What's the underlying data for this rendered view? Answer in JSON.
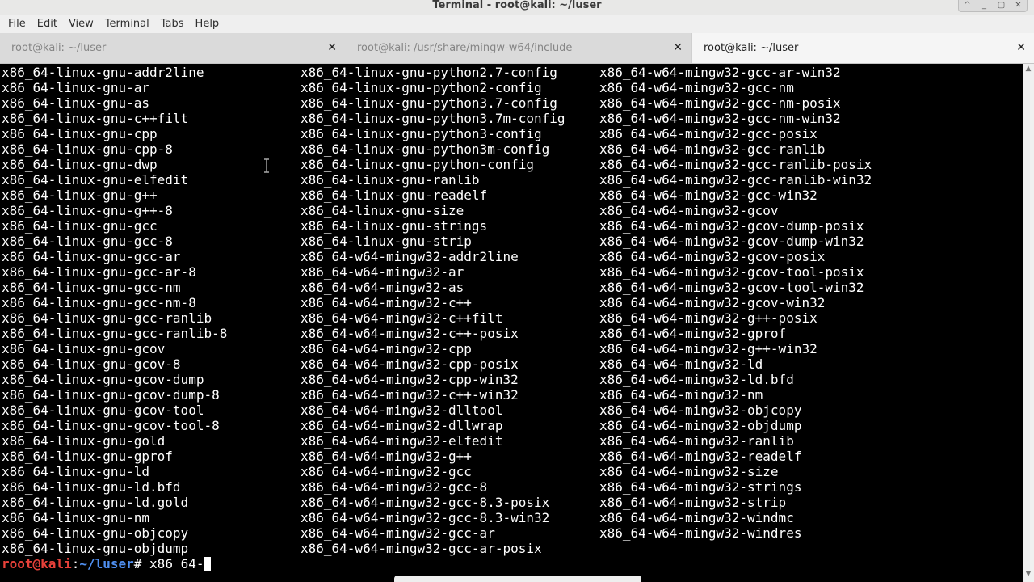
{
  "window": {
    "title": "Terminal - root@kali: ~/luser",
    "controls": [
      "^",
      "_",
      "▢",
      "✕"
    ]
  },
  "menubar": [
    "File",
    "Edit",
    "View",
    "Terminal",
    "Tabs",
    "Help"
  ],
  "tabs": [
    {
      "label": "root@kali: ~/luser",
      "active": false
    },
    {
      "label": "root@kali: /usr/share/mingw-w64/include",
      "active": false
    },
    {
      "label": "root@kali: ~/luser",
      "active": true
    }
  ],
  "tab_close_glyph": "✕",
  "terminal": {
    "columns": [
      [
        "x86_64-linux-gnu-addr2line",
        "x86_64-linux-gnu-ar",
        "x86_64-linux-gnu-as",
        "x86_64-linux-gnu-c++filt",
        "x86_64-linux-gnu-cpp",
        "x86_64-linux-gnu-cpp-8",
        "x86_64-linux-gnu-dwp",
        "x86_64-linux-gnu-elfedit",
        "x86_64-linux-gnu-g++",
        "x86_64-linux-gnu-g++-8",
        "x86_64-linux-gnu-gcc",
        "x86_64-linux-gnu-gcc-8",
        "x86_64-linux-gnu-gcc-ar",
        "x86_64-linux-gnu-gcc-ar-8",
        "x86_64-linux-gnu-gcc-nm",
        "x86_64-linux-gnu-gcc-nm-8",
        "x86_64-linux-gnu-gcc-ranlib",
        "x86_64-linux-gnu-gcc-ranlib-8",
        "x86_64-linux-gnu-gcov",
        "x86_64-linux-gnu-gcov-8",
        "x86_64-linux-gnu-gcov-dump",
        "x86_64-linux-gnu-gcov-dump-8",
        "x86_64-linux-gnu-gcov-tool",
        "x86_64-linux-gnu-gcov-tool-8",
        "x86_64-linux-gnu-gold",
        "x86_64-linux-gnu-gprof",
        "x86_64-linux-gnu-ld",
        "x86_64-linux-gnu-ld.bfd",
        "x86_64-linux-gnu-ld.gold",
        "x86_64-linux-gnu-nm",
        "x86_64-linux-gnu-objcopy",
        "x86_64-linux-gnu-objdump"
      ],
      [
        "x86_64-linux-gnu-python2.7-config",
        "x86_64-linux-gnu-python2-config",
        "x86_64-linux-gnu-python3.7-config",
        "x86_64-linux-gnu-python3.7m-config",
        "x86_64-linux-gnu-python3-config",
        "x86_64-linux-gnu-python3m-config",
        "x86_64-linux-gnu-python-config",
        "x86_64-linux-gnu-ranlib",
        "x86_64-linux-gnu-readelf",
        "x86_64-linux-gnu-size",
        "x86_64-linux-gnu-strings",
        "x86_64-linux-gnu-strip",
        "x86_64-w64-mingw32-addr2line",
        "x86_64-w64-mingw32-ar",
        "x86_64-w64-mingw32-as",
        "x86_64-w64-mingw32-c++",
        "x86_64-w64-mingw32-c++filt",
        "x86_64-w64-mingw32-c++-posix",
        "x86_64-w64-mingw32-cpp",
        "x86_64-w64-mingw32-cpp-posix",
        "x86_64-w64-mingw32-cpp-win32",
        "x86_64-w64-mingw32-c++-win32",
        "x86_64-w64-mingw32-dlltool",
        "x86_64-w64-mingw32-dllwrap",
        "x86_64-w64-mingw32-elfedit",
        "x86_64-w64-mingw32-g++",
        "x86_64-w64-mingw32-gcc",
        "x86_64-w64-mingw32-gcc-8",
        "x86_64-w64-mingw32-gcc-8.3-posix",
        "x86_64-w64-mingw32-gcc-8.3-win32",
        "x86_64-w64-mingw32-gcc-ar",
        "x86_64-w64-mingw32-gcc-ar-posix"
      ],
      [
        "x86_64-w64-mingw32-gcc-ar-win32",
        "x86_64-w64-mingw32-gcc-nm",
        "x86_64-w64-mingw32-gcc-nm-posix",
        "x86_64-w64-mingw32-gcc-nm-win32",
        "x86_64-w64-mingw32-gcc-posix",
        "x86_64-w64-mingw32-gcc-ranlib",
        "x86_64-w64-mingw32-gcc-ranlib-posix",
        "x86_64-w64-mingw32-gcc-ranlib-win32",
        "x86_64-w64-mingw32-gcc-win32",
        "x86_64-w64-mingw32-gcov",
        "x86_64-w64-mingw32-gcov-dump-posix",
        "x86_64-w64-mingw32-gcov-dump-win32",
        "x86_64-w64-mingw32-gcov-posix",
        "x86_64-w64-mingw32-gcov-tool-posix",
        "x86_64-w64-mingw32-gcov-tool-win32",
        "x86_64-w64-mingw32-gcov-win32",
        "x86_64-w64-mingw32-g++-posix",
        "x86_64-w64-mingw32-gprof",
        "x86_64-w64-mingw32-g++-win32",
        "x86_64-w64-mingw32-ld",
        "x86_64-w64-mingw32-ld.bfd",
        "x86_64-w64-mingw32-nm",
        "x86_64-w64-mingw32-objcopy",
        "x86_64-w64-mingw32-objdump",
        "x86_64-w64-mingw32-ranlib",
        "x86_64-w64-mingw32-readelf",
        "x86_64-w64-mingw32-size",
        "x86_64-w64-mingw32-strings",
        "x86_64-w64-mingw32-strip",
        "x86_64-w64-mingw32-windmc",
        "x86_64-w64-mingw32-windres"
      ]
    ],
    "prompt": {
      "user_host": "root@kali",
      "colon": ":",
      "path": "~/luser",
      "symbol": "# ",
      "input": "x86_64-"
    }
  },
  "scrollbar": {
    "up": "▲",
    "down": "▼"
  },
  "colors": {
    "prompt_user": "#e8413a",
    "prompt_path": "#4f8ff0",
    "background": "#000000",
    "foreground": "#ffffff"
  }
}
